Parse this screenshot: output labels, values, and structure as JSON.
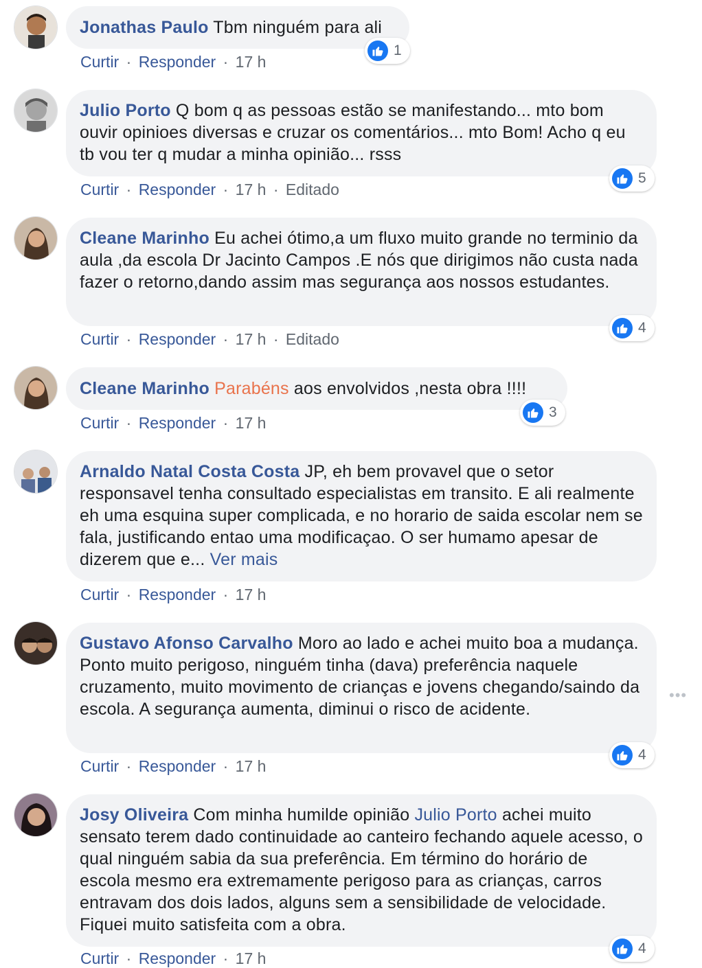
{
  "actions": {
    "like": "Curtir",
    "reply": "Responder",
    "dot": "·",
    "edited": "Editado"
  },
  "comments": [
    {
      "author": "Jonathas Paulo",
      "text": "Tbm ninguém para ali",
      "time": "17 h",
      "likes": "1"
    },
    {
      "author": "Julio Porto",
      "text": "Q bom q as pessoas estão se manifestando... mto bom ouvir opinioes diversas e cruzar os comentários... mto Bom! Acho q eu tb vou ter q mudar a minha opinião... rsss",
      "time": "17 h",
      "likes": "5"
    },
    {
      "author": "Cleane Marinho",
      "text": "Eu achei ótimo,a um fluxo muito grande no terminio da aula ,da escola Dr Jacinto Campos .E nós que dirigimos não custa nada fazer o retorno,dando assim mas segurança aos nossos estudantes.",
      "time": "17 h",
      "likes": "4"
    },
    {
      "author": "Cleane Marinho",
      "highlight": "Parabéns",
      "text": "aos envolvidos ,nesta obra !!!!",
      "time": "17 h",
      "likes": "3"
    },
    {
      "author": "Arnaldo Natal Costa Costa",
      "text": "JP, eh bem provavel que o setor responsavel tenha consultado especialistas em transito. E ali realmente eh uma esquina super complicada, e no horario de saida escolar nem se fala, justificando entao uma modificaçao. O ser humamo apesar de dizerem que e...",
      "see_more": "Ver mais",
      "time": "17 h"
    },
    {
      "author": "Gustavo Afonso Carvalho",
      "text": "Moro ao lado e achei muito boa a mudança. Ponto muito perigoso, ninguém tinha (dava) preferência naquele cruzamento, muito movimento de crianças e jovens chegando/saindo da escola. A segurança aumenta, diminui o risco de acidente.",
      "time": "17 h",
      "likes": "4",
      "menu": "•••"
    },
    {
      "author": "Josy Oliveira",
      "text_before": "Com minha humilde opinião",
      "mention": "Julio Porto",
      "text_after": "achei muito sensato terem dado continuidade ao canteiro fechando aquele acesso, o qual ninguém sabia da sua preferência. Em término do horário de escola mesmo era extremamente perigoso para as crianças, carros entravam dos dois lados, alguns sem a sensibilidade de velocidade. Fiquei muito satisfeita com a obra.",
      "time": "17 h",
      "likes": "4"
    }
  ],
  "colors": {
    "link": "#385898",
    "bubble": "#f2f3f5",
    "like": "#1877f2",
    "highlight": "#e9734c",
    "meta": "#606770"
  }
}
